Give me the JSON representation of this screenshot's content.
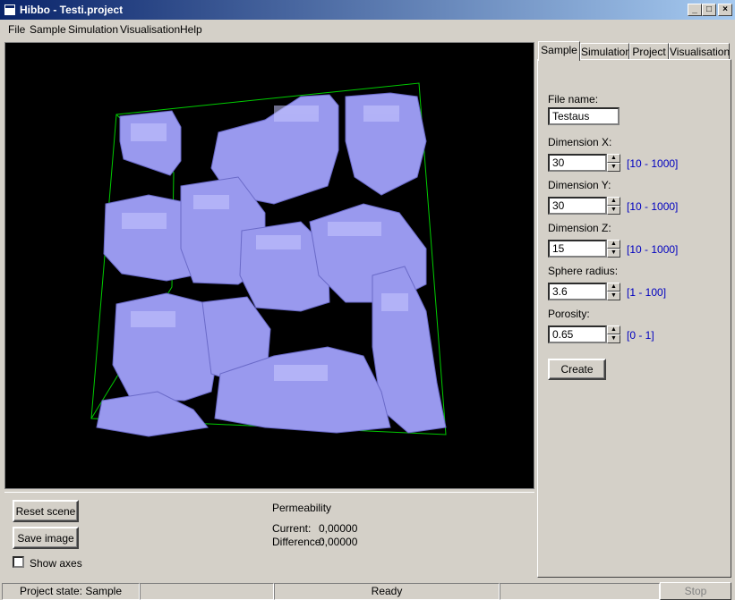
{
  "window": {
    "title": "Hibbo - Testi.project",
    "minimize_glyph": "_",
    "maximize_glyph": "□",
    "close_glyph": "×"
  },
  "menu": [
    "File",
    "Sample",
    "Simulation",
    "Visualisation",
    "Help"
  ],
  "tabs": [
    "Sample",
    "Simulation",
    "Project",
    "Visualisation"
  ],
  "form": {
    "file_name": {
      "label": "File name:",
      "value": "Testaus"
    },
    "dim_x": {
      "label": "Dimension X:",
      "value": "30",
      "range": "[10 - 1000]"
    },
    "dim_y": {
      "label": "Dimension Y:",
      "value": "30",
      "range": "[10 - 1000]"
    },
    "dim_z": {
      "label": "Dimension Z:",
      "value": "15",
      "range": "[10 - 1000]"
    },
    "radius": {
      "label": "Sphere radius:",
      "value": "3.6",
      "range": "[1 - 100]"
    },
    "porosity": {
      "label": "Porosity:",
      "value": "0.65",
      "range": "[0 - 1]"
    },
    "create_label": "Create"
  },
  "controls": {
    "reset_label": "Reset scene",
    "save_label": "Save image",
    "show_axes_label": "Show axes"
  },
  "permeability": {
    "title": "Permeability",
    "current_label": "Current:",
    "current_value": "0,00000",
    "difference_label": "Difference:",
    "difference_value": "0,00000"
  },
  "status": {
    "project_state": "Project state: Sample",
    "ready": "Ready",
    "stop_label": "Stop"
  },
  "colors": {
    "voxel": "#9999ee",
    "voxel_dark": "#6a6ac8",
    "box_edge": "#00cc00",
    "range_text": "#0000c0"
  }
}
